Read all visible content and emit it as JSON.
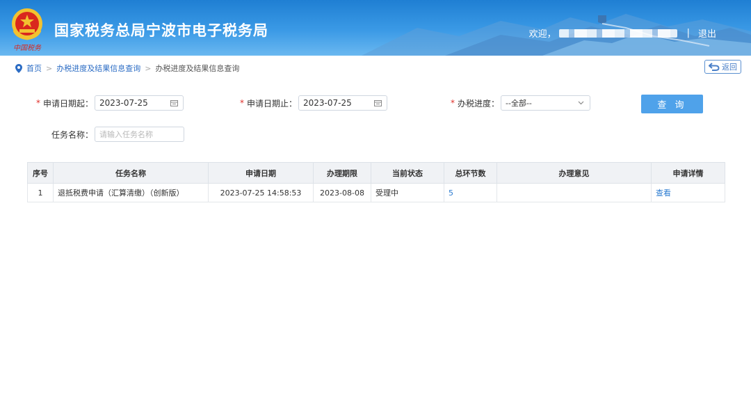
{
  "header": {
    "site_title": "国家税务总局宁波市电子税务局",
    "logo_caption": "中国税务",
    "welcome": "欢迎，",
    "separator": "|",
    "logout": "退出",
    "bg_color": "#2b8ae0"
  },
  "breadcrumb": {
    "home": "首页",
    "level1": "办税进度及结果信息查询",
    "level2": "办税进度及结果信息查询",
    "separator": ">"
  },
  "back_button": {
    "label": "返回"
  },
  "form": {
    "start_date": {
      "label": "申请日期起：",
      "value": "2023-07-25"
    },
    "end_date": {
      "label": "申请日期止：",
      "value": "2023-07-25"
    },
    "progress": {
      "label": "办税进度：",
      "selected": "--全部--"
    },
    "task_name": {
      "label": "任务名称：",
      "placeholder": "请输入任务名称"
    },
    "required_mark": "*",
    "query_button": "查 询"
  },
  "table": {
    "columns": [
      "序号",
      "任务名称",
      "申请日期",
      "办理期限",
      "当前状态",
      "总环节数",
      "办理意见",
      "申请详情"
    ],
    "rows": [
      {
        "index": "1",
        "task": "退抵税费申请（汇算清缴）（创新版）",
        "apply_date": "2023-07-25 14:58:53",
        "deadline": "2023-08-08",
        "status": "受理中",
        "steps": "5",
        "opinion": "",
        "detail": "查看"
      }
    ]
  }
}
